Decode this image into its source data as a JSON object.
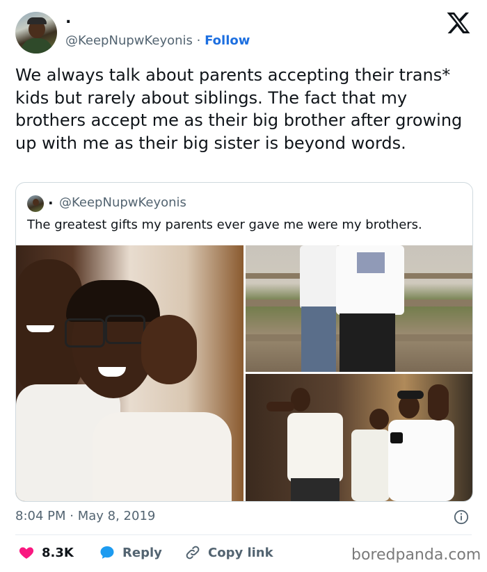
{
  "author": {
    "display_name": ".",
    "handle": "@KeepNupwKeyonis",
    "separator": " · ",
    "follow_label": "Follow"
  },
  "tweet": {
    "text": "We always talk about parents accepting  their trans* kids but rarely about siblings. The fact that my brothers accept me as their big brother after growing up with me as their big sister is beyond words."
  },
  "quoted_tweet": {
    "display_name": ".",
    "handle": "@KeepNupwKeyonis",
    "text": "The greatest gifts my parents ever gave me were my brothers."
  },
  "meta": {
    "time": "8:04 PM",
    "separator": " · ",
    "date": "May 8, 2019"
  },
  "actions": {
    "like_count": "8.3K",
    "reply_label": "Reply",
    "copy_link_label": "Copy link"
  },
  "watermark": "boredpanda.com",
  "colors": {
    "like": "#f91880",
    "reply": "#1d9bf0",
    "follow": "#1d6fe0",
    "muted": "#536471"
  }
}
